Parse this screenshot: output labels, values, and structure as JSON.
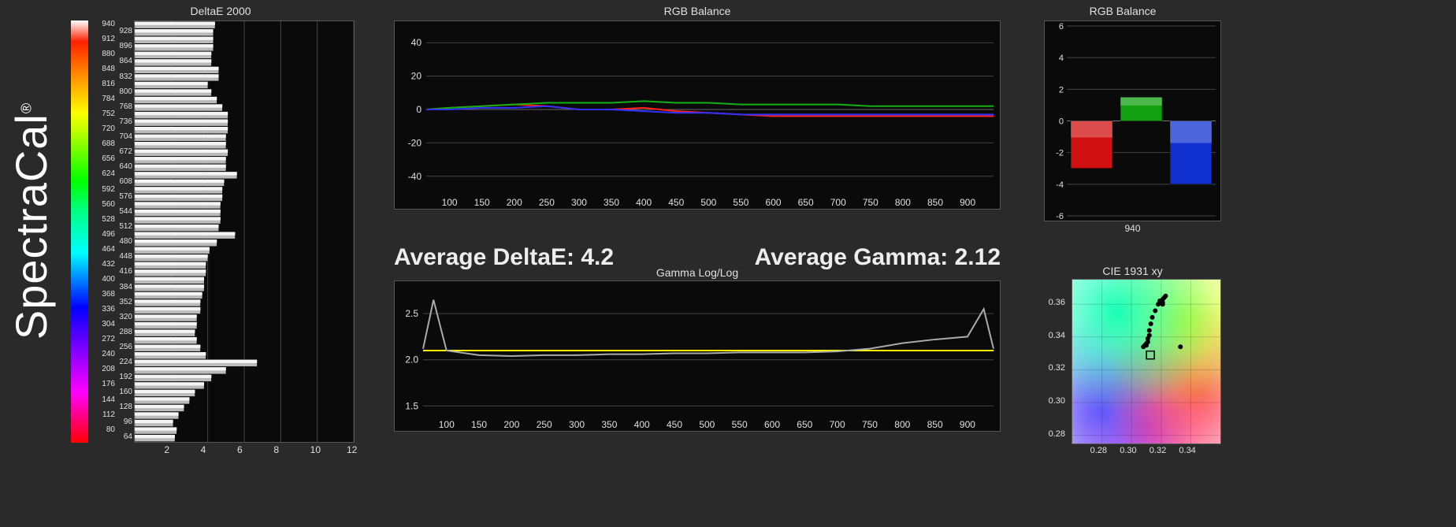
{
  "logo": {
    "text": "SpectraCal",
    "reg": "®"
  },
  "averages": {
    "deltae_label": "Average DeltaE:",
    "deltae_value": "4.2",
    "gamma_label": "Average Gamma:",
    "gamma_value": "2.12"
  },
  "chart_data": [
    {
      "id": "deltae",
      "type": "bar",
      "orientation": "horizontal",
      "title": "DeltaE 2000",
      "xlabel": "",
      "ylabel": "",
      "xlim": [
        0,
        12
      ],
      "xticks": [
        2,
        4,
        6,
        8,
        10,
        12
      ],
      "categories": [
        64,
        80,
        96,
        112,
        128,
        144,
        160,
        176,
        192,
        208,
        224,
        240,
        256,
        272,
        288,
        304,
        320,
        336,
        352,
        368,
        384,
        400,
        416,
        432,
        448,
        464,
        480,
        496,
        512,
        528,
        544,
        560,
        576,
        592,
        608,
        624,
        640,
        656,
        672,
        688,
        704,
        720,
        736,
        752,
        768,
        784,
        800,
        816,
        832,
        848,
        864,
        880,
        896,
        912,
        928,
        940
      ],
      "values": [
        2.2,
        2.3,
        2.1,
        2.4,
        2.7,
        3.0,
        3.3,
        3.8,
        4.2,
        5.0,
        6.7,
        3.9,
        3.6,
        3.4,
        3.3,
        3.4,
        3.4,
        3.6,
        3.6,
        3.7,
        3.8,
        3.8,
        3.9,
        3.9,
        4.0,
        4.1,
        4.5,
        5.5,
        4.6,
        4.7,
        4.7,
        4.7,
        4.8,
        4.8,
        4.9,
        5.6,
        5.0,
        5.0,
        5.1,
        5.0,
        5.0,
        5.1,
        5.1,
        5.1,
        4.8,
        4.5,
        4.2,
        4.0,
        4.6,
        4.6,
        4.2,
        4.2,
        4.3,
        4.3,
        4.3,
        4.4
      ]
    },
    {
      "id": "rgb_balance_line",
      "type": "line",
      "title": "RGB Balance",
      "xlim": [
        64,
        940
      ],
      "ylim": [
        -50,
        50
      ],
      "xticks": [
        100,
        150,
        200,
        250,
        300,
        350,
        400,
        450,
        500,
        550,
        600,
        650,
        700,
        750,
        800,
        850,
        900
      ],
      "yticks": [
        -40,
        -20,
        0,
        20,
        40
      ],
      "x": [
        64,
        100,
        150,
        200,
        250,
        300,
        350,
        400,
        450,
        500,
        550,
        600,
        650,
        700,
        750,
        800,
        850,
        900,
        940
      ],
      "series": [
        {
          "name": "R",
          "color": "#ff2020",
          "values": [
            0,
            1,
            2,
            3,
            2,
            0,
            0,
            1,
            -1,
            -2,
            -3,
            -4,
            -4,
            -4,
            -4,
            -4,
            -4,
            -4,
            -4
          ]
        },
        {
          "name": "G",
          "color": "#10b010",
          "values": [
            0,
            1,
            2,
            3,
            4,
            4,
            4,
            5,
            4,
            4,
            3,
            3,
            3,
            3,
            2,
            2,
            2,
            2,
            2
          ]
        },
        {
          "name": "B",
          "color": "#3030ff",
          "values": [
            0,
            0,
            1,
            1,
            2,
            0,
            0,
            -1,
            -2,
            -2,
            -3,
            -3,
            -3,
            -3,
            -3,
            -3,
            -3,
            -3,
            -3
          ]
        }
      ]
    },
    {
      "id": "rgb_balance_bar",
      "type": "bar",
      "title": "RGB Balance",
      "xlabel": "940",
      "ylim": [
        -6,
        6
      ],
      "yticks": [
        -6,
        -4,
        -2,
        0,
        2,
        4,
        6
      ],
      "categories": [
        "R",
        "G",
        "B"
      ],
      "values": [
        -3.0,
        1.5,
        -4.0
      ],
      "colors": [
        "#d01010",
        "#10a010",
        "#1030d0"
      ]
    },
    {
      "id": "gamma",
      "type": "line",
      "title": "Gamma Log/Log",
      "xlim": [
        64,
        940
      ],
      "ylim": [
        1.4,
        2.8
      ],
      "xticks": [
        100,
        150,
        200,
        250,
        300,
        350,
        400,
        450,
        500,
        550,
        600,
        650,
        700,
        750,
        800,
        850,
        900
      ],
      "yticks": [
        1.5,
        2.0,
        2.5
      ],
      "target": 2.1,
      "x": [
        64,
        80,
        100,
        150,
        200,
        250,
        300,
        350,
        400,
        450,
        500,
        550,
        600,
        650,
        700,
        750,
        800,
        850,
        900,
        925,
        940
      ],
      "values": [
        2.12,
        2.65,
        2.1,
        2.05,
        2.04,
        2.05,
        2.05,
        2.06,
        2.06,
        2.07,
        2.07,
        2.08,
        2.08,
        2.08,
        2.09,
        2.12,
        2.18,
        2.22,
        2.25,
        2.55,
        2.12
      ]
    },
    {
      "id": "cie",
      "type": "scatter",
      "title": "CIE 1931 xy",
      "xlim": [
        0.26,
        0.36
      ],
      "ylim": [
        0.275,
        0.375
      ],
      "xticks": [
        0.28,
        0.3,
        0.32,
        0.34
      ],
      "yticks": [
        0.28,
        0.3,
        0.32,
        0.34,
        0.36
      ],
      "target": {
        "x": 0.3127,
        "y": 0.329
      },
      "points": [
        {
          "x": 0.308,
          "y": 0.334
        },
        {
          "x": 0.309,
          "y": 0.335
        },
        {
          "x": 0.31,
          "y": 0.335
        },
        {
          "x": 0.31,
          "y": 0.336
        },
        {
          "x": 0.311,
          "y": 0.337
        },
        {
          "x": 0.311,
          "y": 0.339
        },
        {
          "x": 0.312,
          "y": 0.341
        },
        {
          "x": 0.312,
          "y": 0.344
        },
        {
          "x": 0.313,
          "y": 0.348
        },
        {
          "x": 0.314,
          "y": 0.352
        },
        {
          "x": 0.316,
          "y": 0.356
        },
        {
          "x": 0.318,
          "y": 0.36
        },
        {
          "x": 0.319,
          "y": 0.362
        },
        {
          "x": 0.322,
          "y": 0.364
        },
        {
          "x": 0.32,
          "y": 0.362
        },
        {
          "x": 0.321,
          "y": 0.361
        },
        {
          "x": 0.321,
          "y": 0.363
        },
        {
          "x": 0.323,
          "y": 0.365
        },
        {
          "x": 0.333,
          "y": 0.334
        },
        {
          "x": 0.321,
          "y": 0.36
        }
      ]
    }
  ]
}
